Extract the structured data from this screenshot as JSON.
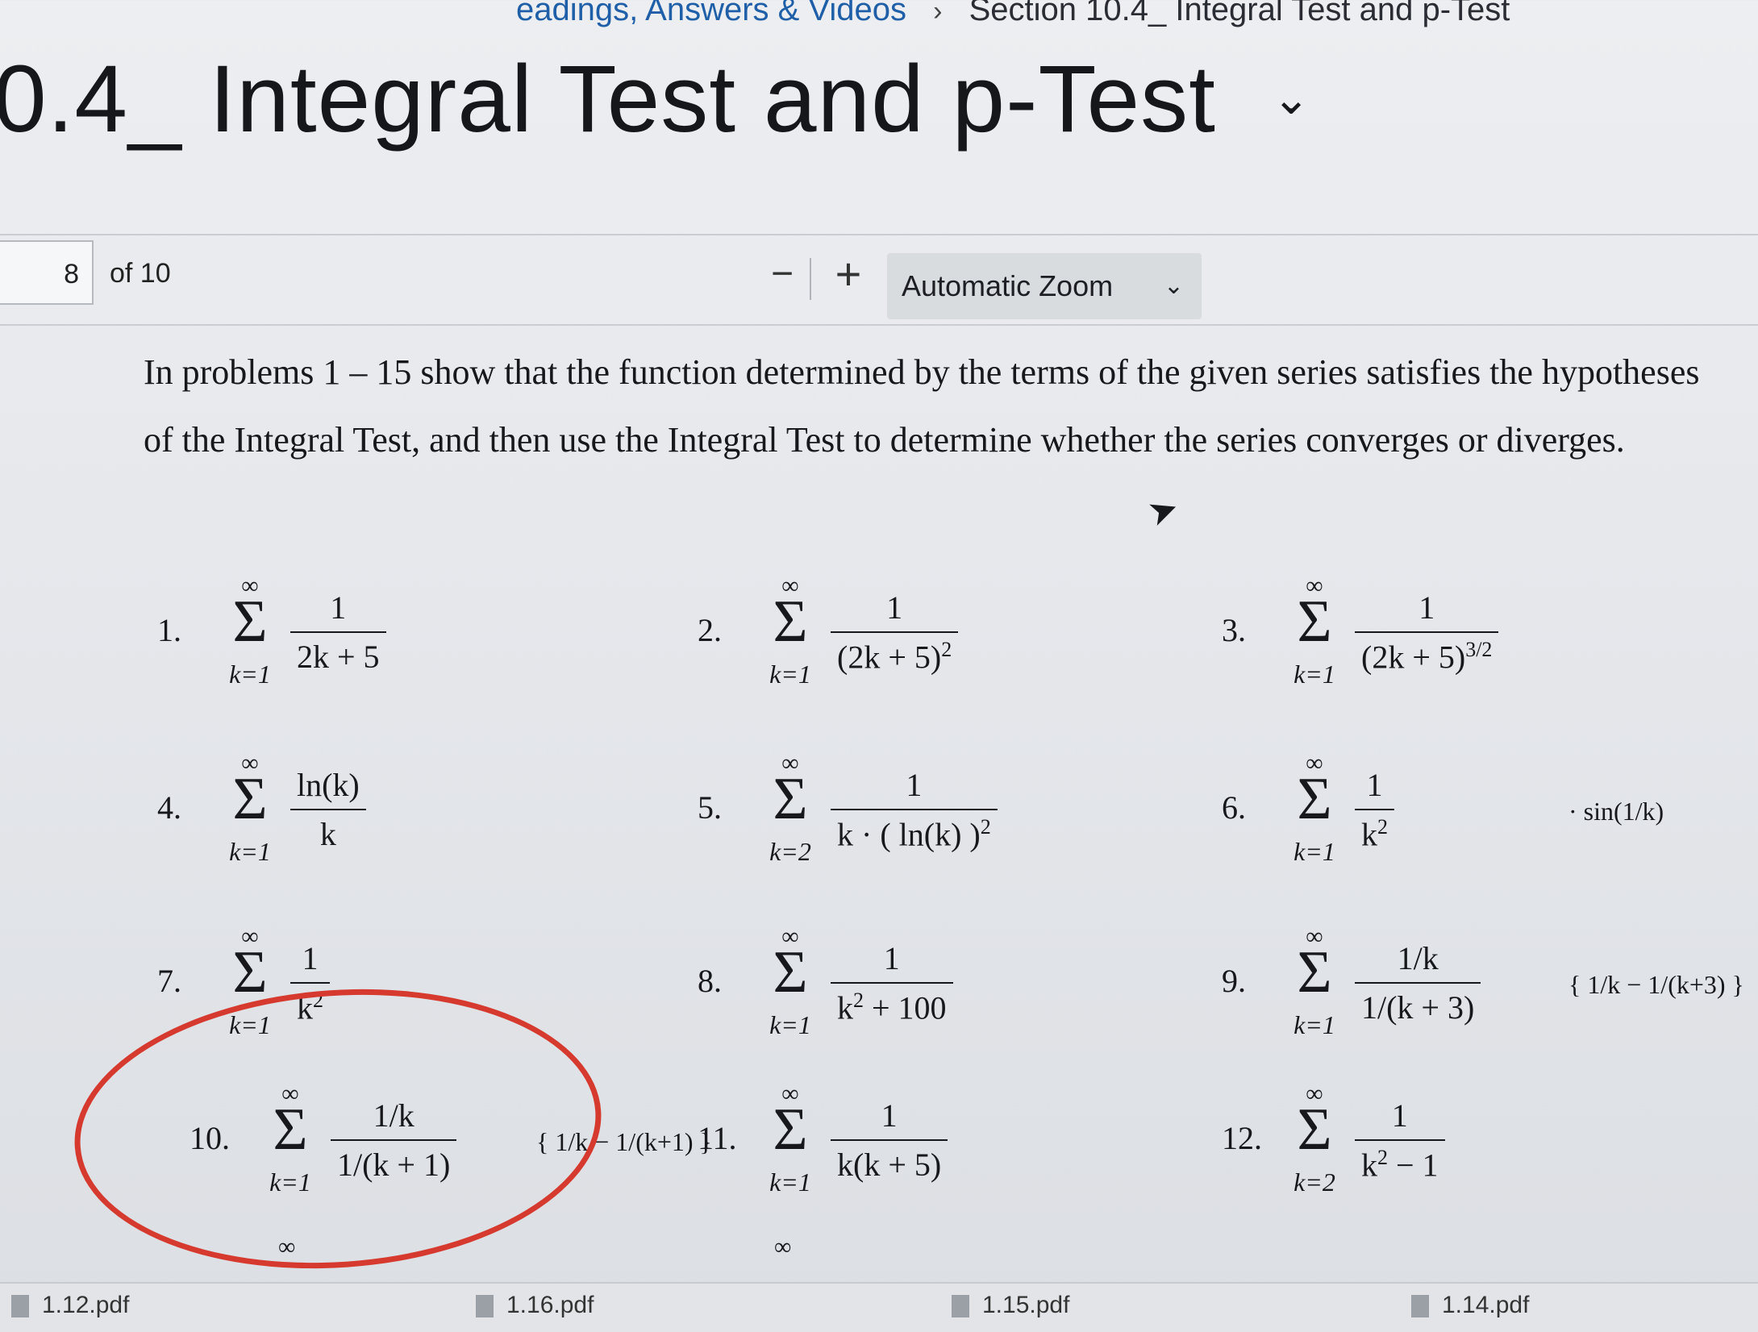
{
  "breadcrumb": {
    "parent": "eadings, Answers & Videos",
    "separator": "›",
    "current": "Section 10.4_ Integral Test and p-Test"
  },
  "page_title": "0.4_ Integral Test and p-Test",
  "title_chevron": "⌄",
  "toolbar": {
    "page_number": "8",
    "page_of": "of 10",
    "zoom_out": "−",
    "zoom_in": "+",
    "zoom_value": "Automatic Zoom",
    "zoom_chevron": "⌄"
  },
  "document": {
    "instructions": "In problems 1 – 15  show that the function determined by the terms of the given series satisfies the hypotheses of the Integral Test, and then use the Integral Test to determine whether the series converges or diverges.",
    "problems": [
      {
        "n": "1.",
        "top": "∞",
        "bottom": "k=1",
        "num": "1",
        "den": "2k + 5"
      },
      {
        "n": "2.",
        "top": "∞",
        "bottom": "k=1",
        "num": "1",
        "den": "(2k + 5)",
        "den_sup": "2"
      },
      {
        "n": "3.",
        "top": "∞",
        "bottom": "k=1",
        "num": "1",
        "den": "(2k + 5)",
        "den_sup": "3/2"
      },
      {
        "n": "4.",
        "top": "∞",
        "bottom": "k=1",
        "num": "ln(k)",
        "den": "k"
      },
      {
        "n": "5.",
        "top": "∞",
        "bottom": "k=2",
        "num": "1",
        "den": "k · ( ln(k) )",
        "den_sup": "2"
      },
      {
        "n": "6.",
        "top": "∞",
        "bottom": "k=1",
        "num": "1",
        "den": "k",
        "den_sup": "2",
        "extra": "· sin(1/k)"
      },
      {
        "n": "7.",
        "top": "∞",
        "bottom": "k=1",
        "num": "1",
        "den": "k",
        "den_sup": "2"
      },
      {
        "n": "8.",
        "top": "∞",
        "bottom": "k=1",
        "num": "1",
        "den": "k",
        "den_sup": "2",
        "den_tail": " + 100"
      },
      {
        "n": "9.",
        "top": "∞",
        "bottom": "k=1",
        "num": "1/k",
        "den": "1/(k + 3)",
        "extra": "{ 1/k − 1/(k+3) }"
      },
      {
        "n": "10.",
        "top": "∞",
        "bottom": "k=1",
        "num": "1/k",
        "den": "1/(k + 1)",
        "extra": "{ 1/k − 1/(k+1) }"
      },
      {
        "n": "11.",
        "top": "∞",
        "bottom": "k=1",
        "num": "1",
        "den": "k(k + 5)"
      },
      {
        "n": "12.",
        "top": "∞",
        "bottom": "k=2",
        "num": "1",
        "den": "k",
        "den_sup": "2",
        "den_tail": " − 1"
      }
    ],
    "trailing_infinity": "∞"
  },
  "downloads": [
    {
      "name": "1.12.pdf"
    },
    {
      "name": "1.16.pdf"
    },
    {
      "name": "1.15.pdf"
    },
    {
      "name": "1.14.pdf"
    }
  ],
  "colors": {
    "annotation_circle": "#d63a2f",
    "breadcrumb_link": "#1f5fa8"
  }
}
